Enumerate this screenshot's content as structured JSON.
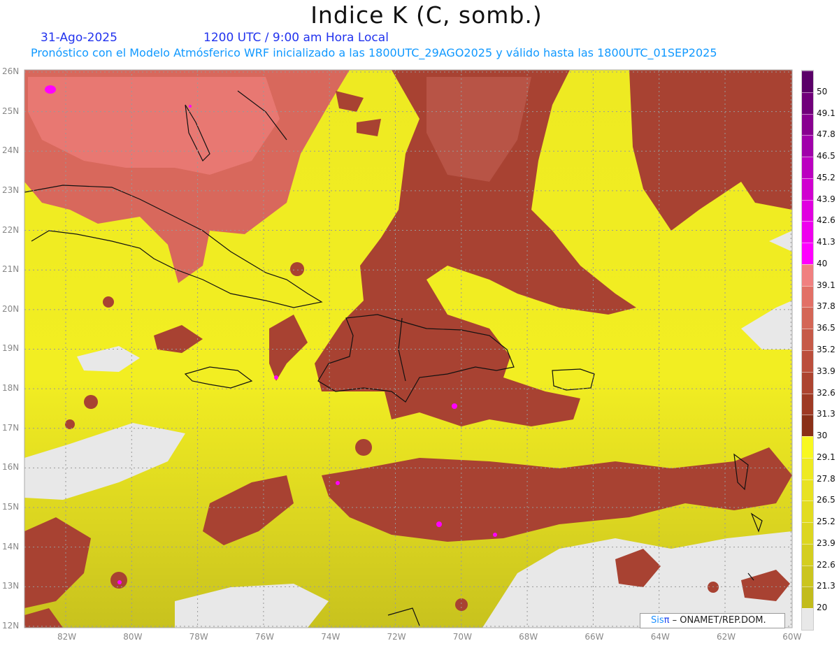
{
  "header": {
    "title": "Indice K (C, somb.)",
    "date": "31-Ago-2025",
    "time": "1200 UTC / 9:00 am Hora Local",
    "subtitle": "Pronóstico con el Modelo Atmósferico WRF inicializado a las 1800UTC_29AGO2025 y válido hasta las  1800UTC_01SEP2025"
  },
  "map": {
    "lon_ticks": [
      "82W",
      "80W",
      "78W",
      "76W",
      "74W",
      "72W",
      "70W",
      "68W",
      "66W",
      "64W",
      "62W",
      "60W"
    ],
    "lon_values": [
      -82,
      -80,
      -78,
      -76,
      -74,
      -72,
      -70,
      -68,
      -66,
      -64,
      -62,
      -60
    ],
    "lat_ticks": [
      "26N",
      "25N",
      "24N",
      "23N",
      "22N",
      "21N",
      "20N",
      "19N",
      "18N",
      "17N",
      "16N",
      "15N",
      "14N",
      "13N",
      "12N"
    ],
    "lat_values": [
      26,
      25,
      24,
      23,
      22,
      21,
      20,
      19,
      18,
      17,
      16,
      15,
      14,
      13,
      12
    ]
  },
  "colorbar": {
    "labels": [
      "20",
      "21.3",
      "22.6",
      "23.9",
      "25.2",
      "26.5",
      "27.8",
      "29.1",
      "30",
      "31.3",
      "32.6",
      "33.9",
      "35.2",
      "36.5",
      "37.8",
      "39.1",
      "40",
      "41.3",
      "42.6",
      "43.9",
      "45.2",
      "46.5",
      "47.8",
      "49.1",
      "50"
    ],
    "colors": [
      "#e8e8e8",
      "#c2bc1c",
      "#cbc51e",
      "#d4ce1f",
      "#dcd620",
      "#e2dc20",
      "#e8e221",
      "#eeea22",
      "#f8f820",
      "#8a3018",
      "#9e3a24",
      "#ad4430",
      "#bb4e3c",
      "#c65a48",
      "#d46656",
      "#e27066",
      "#f08080",
      "#ff00ff",
      "#ee00ee",
      "#e000e0",
      "#d000d0",
      "#bb00c0",
      "#a000aa",
      "#880090",
      "#70007a",
      "#5a0068"
    ]
  },
  "credit": {
    "brand": "Sis",
    "brand_pi": "π",
    "text": " –  ONAMET/REP.DOM."
  }
}
